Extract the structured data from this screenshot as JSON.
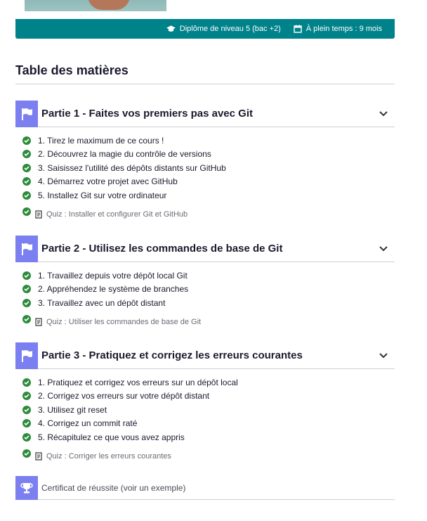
{
  "info_bar": {
    "diploma": "Diplôme de niveau 5 (bac +2)",
    "schedule": "À plein temps : 9 mois"
  },
  "toc": {
    "title": "Table des matières",
    "parts": [
      {
        "title": "Partie 1 - Faites vos premiers pas avec Git",
        "lessons": [
          "1. Tirez le maximum de ce cours !",
          "2. Découvrez la magie du contrôle de versions",
          "3. Saisissez l'utilité des dépôts distants sur GitHub",
          "4. Démarrez votre projet avec GitHub",
          "5. Installez Git sur votre ordinateur"
        ],
        "quiz": "Quiz : Installer et configurer Git et GitHub"
      },
      {
        "title": "Partie 2 - Utilisez les commandes de base de Git",
        "lessons": [
          "1. Travaillez depuis votre dépôt local Git",
          "2. Appréhendez le système de branches",
          "3. Travaillez avec un dépôt distant"
        ],
        "quiz": "Quiz : Utiliser les commandes de base de Git"
      },
      {
        "title": "Partie 3 - Pratiquez et corrigez les erreurs courantes",
        "lessons": [
          "1. Pratiquez et corrigez vos erreurs sur un dépôt local",
          "2. Corrigez vos erreurs sur votre dépôt distant",
          "3. Utilisez git reset",
          "4. Corrigez un commit raté",
          "5. Récapitulez ce que vous avez appris"
        ],
        "quiz": "Quiz : Corriger les erreurs courantes"
      }
    ],
    "certificate": "Certificat de réussite (voir un exemple)"
  },
  "colors": {
    "info_bar_bg": "#00828b",
    "part_icon_bg": "#7b7ff0",
    "check": "#2d8b3c"
  }
}
